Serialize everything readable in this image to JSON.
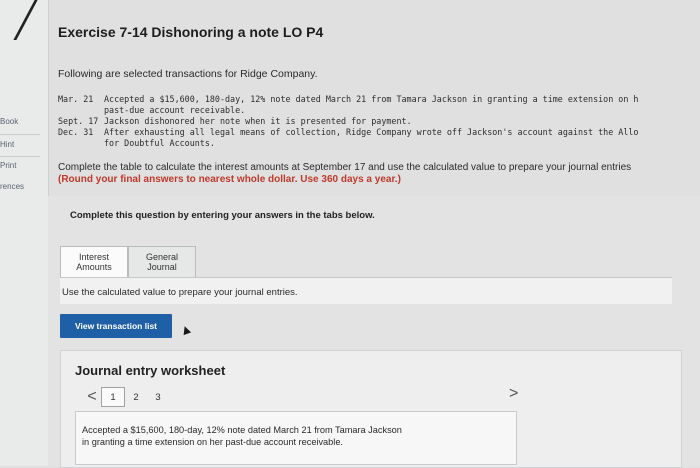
{
  "sidebar": {
    "items": [
      "Book",
      "Hint",
      "Print",
      "rences"
    ]
  },
  "exercise": {
    "title": "Exercise 7-14 Dishonoring a note LO P4",
    "intro": "Following are selected transactions for Ridge Company.",
    "transactions": [
      {
        "date": "Mar. 21",
        "text": "Accepted a $15,600, 180-day, 12% note dated March 21 from Tamara Jackson in granting a time extension on h"
      },
      {
        "date": "",
        "text": "past-due account receivable."
      },
      {
        "date": "Sept. 17",
        "text": "Jackson dishonored her note when it is presented for payment."
      },
      {
        "date": "Dec. 31",
        "text": "After exhausting all legal means of collection, Ridge Company wrote off Jackson's account against the Allo"
      },
      {
        "date": "",
        "text": "for Doubtful Accounts."
      }
    ],
    "instruction_line1": "Complete the table to calculate the interest amounts at September 17 and use the calculated value to prepare your journal entries",
    "instruction_red": "(Round your final answers to nearest whole dollar. Use 360 days a year.)"
  },
  "question": {
    "complete_text": "Complete this question by entering your answers in the tabs below.",
    "tabs": [
      {
        "label_line1": "Interest",
        "label_line2": "Amounts"
      },
      {
        "label_line1": "General",
        "label_line2": "Journal"
      }
    ],
    "tab_instruction": "Use the calculated value to prepare your journal entries."
  },
  "view_button": "View transaction list",
  "worksheet": {
    "title": "Journal entry worksheet",
    "prev": "<",
    "next": ">",
    "pages": [
      "1",
      "2",
      "3"
    ],
    "description_line1": "Accepted a $15,600, 180-day, 12% note dated March 21 from Tamara Jackson",
    "description_line2": "in granting a time extension on her past-due account receivable."
  }
}
